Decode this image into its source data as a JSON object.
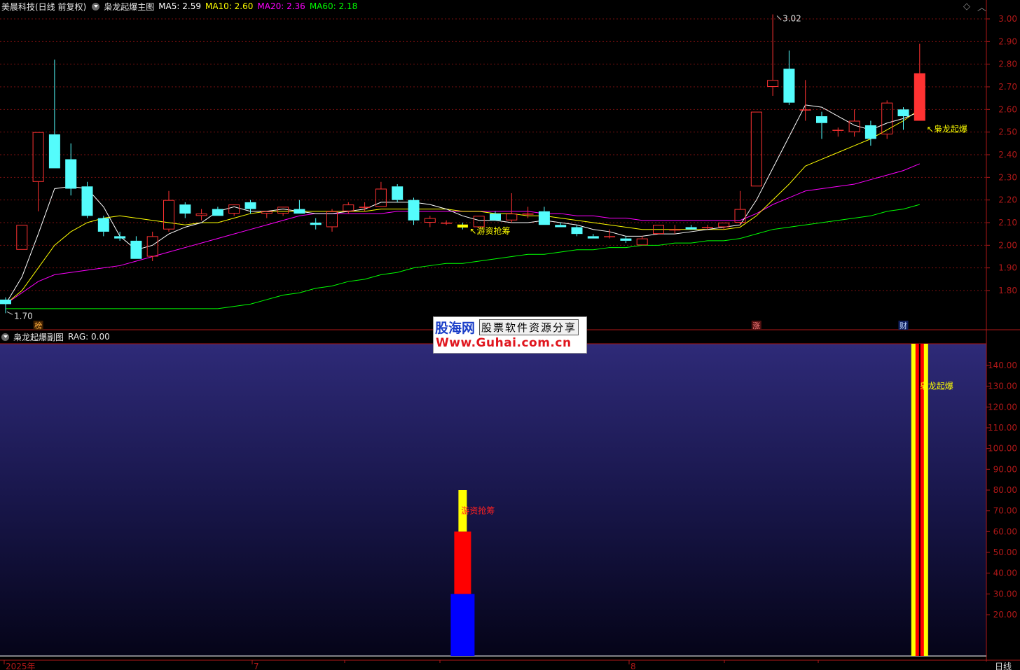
{
  "header": {
    "stock": "美晨科技(日线 前复权)",
    "indicator": "枭龙起爆主图",
    "ma": [
      {
        "label": "MA5: 2.59",
        "color": "#ffffff"
      },
      {
        "label": "MA10: 2.60",
        "color": "#ffff00"
      },
      {
        "label": "MA20: 2.36",
        "color": "#ff00ff"
      },
      {
        "label": "MA60: 2.18",
        "color": "#00ff00"
      }
    ]
  },
  "sub_header": {
    "title": "枭龙起爆副图",
    "value": "RAG: 0.00"
  },
  "watermark": {
    "brand": "股海网",
    "tagline": "股票软件资源分享",
    "url": "Www.Guhai.com.cn"
  },
  "x_axis": {
    "labels": [
      "2025年",
      "7",
      "8"
    ],
    "period": "日线"
  },
  "colors": {
    "up": "#ff3232",
    "down": "#54fcfc",
    "ma5": "#ffffff",
    "ma10": "#ffff00",
    "ma20": "#ff00ff",
    "ma60": "#00ff00",
    "axis": "#b01818"
  },
  "chart_data": [
    {
      "type": "candlestick",
      "ylim": [
        1.7,
        3.06
      ],
      "y_ticks": [
        1.8,
        1.9,
        2.0,
        2.1,
        2.2,
        2.3,
        2.4,
        2.5,
        2.6,
        2.7,
        2.8,
        2.9,
        3.0
      ],
      "candles": [
        {
          "o": 1.76,
          "h": 1.77,
          "l": 1.7,
          "c": 1.74
        },
        {
          "o": 1.98,
          "h": 2.09,
          "l": 1.98,
          "c": 2.09
        },
        {
          "o": 2.28,
          "h": 2.5,
          "l": 2.15,
          "c": 2.5
        },
        {
          "o": 2.49,
          "h": 2.82,
          "l": 2.34,
          "c": 2.34
        },
        {
          "o": 2.38,
          "h": 2.45,
          "l": 2.22,
          "c": 2.25
        },
        {
          "o": 2.26,
          "h": 2.28,
          "l": 2.12,
          "c": 2.13
        },
        {
          "o": 2.12,
          "h": 2.13,
          "l": 2.04,
          "c": 2.06
        },
        {
          "o": 2.04,
          "h": 2.06,
          "l": 2.02,
          "c": 2.03
        },
        {
          "o": 2.02,
          "h": 2.04,
          "l": 1.94,
          "c": 1.94
        },
        {
          "o": 1.95,
          "h": 2.06,
          "l": 1.93,
          "c": 2.04
        },
        {
          "o": 2.07,
          "h": 2.24,
          "l": 2.06,
          "c": 2.2
        },
        {
          "o": 2.18,
          "h": 2.19,
          "l": 2.12,
          "c": 2.14
        },
        {
          "o": 2.13,
          "h": 2.16,
          "l": 2.11,
          "c": 2.14
        },
        {
          "o": 2.16,
          "h": 2.17,
          "l": 2.13,
          "c": 2.13
        },
        {
          "o": 2.14,
          "h": 2.18,
          "l": 2.13,
          "c": 2.18
        },
        {
          "o": 2.19,
          "h": 2.2,
          "l": 2.14,
          "c": 2.16
        },
        {
          "o": 2.14,
          "h": 2.15,
          "l": 2.12,
          "c": 2.15
        },
        {
          "o": 2.14,
          "h": 2.17,
          "l": 2.13,
          "c": 2.17
        },
        {
          "o": 2.16,
          "h": 2.2,
          "l": 2.14,
          "c": 2.14
        },
        {
          "o": 2.1,
          "h": 2.12,
          "l": 2.07,
          "c": 2.09
        },
        {
          "o": 2.08,
          "h": 2.16,
          "l": 2.06,
          "c": 2.15
        },
        {
          "o": 2.15,
          "h": 2.19,
          "l": 2.14,
          "c": 2.18
        },
        {
          "o": 2.17,
          "h": 2.19,
          "l": 2.15,
          "c": 2.17
        },
        {
          "o": 2.17,
          "h": 2.28,
          "l": 2.17,
          "c": 2.25
        },
        {
          "o": 2.26,
          "h": 2.27,
          "l": 2.19,
          "c": 2.2
        },
        {
          "o": 2.2,
          "h": 2.21,
          "l": 2.09,
          "c": 2.11
        },
        {
          "o": 2.1,
          "h": 2.13,
          "l": 2.08,
          "c": 2.12
        },
        {
          "o": 2.1,
          "h": 2.11,
          "l": 2.09,
          "c": 2.1
        },
        {
          "o": 2.09,
          "h": 2.1,
          "l": 2.07,
          "c": 2.08
        },
        {
          "o": 2.08,
          "h": 2.13,
          "l": 2.08,
          "c": 2.13
        },
        {
          "o": 2.14,
          "h": 2.15,
          "l": 2.11,
          "c": 2.11
        },
        {
          "o": 2.11,
          "h": 2.23,
          "l": 2.1,
          "c": 2.14
        },
        {
          "o": 2.14,
          "h": 2.17,
          "l": 2.12,
          "c": 2.14
        },
        {
          "o": 2.15,
          "h": 2.17,
          "l": 2.09,
          "c": 2.09
        },
        {
          "o": 2.09,
          "h": 2.1,
          "l": 2.08,
          "c": 2.08
        },
        {
          "o": 2.08,
          "h": 2.09,
          "l": 2.04,
          "c": 2.05
        },
        {
          "o": 2.04,
          "h": 2.05,
          "l": 2.03,
          "c": 2.03
        },
        {
          "o": 2.04,
          "h": 2.07,
          "l": 2.03,
          "c": 2.04
        },
        {
          "o": 2.03,
          "h": 2.04,
          "l": 2.01,
          "c": 2.02
        },
        {
          "o": 2.0,
          "h": 2.04,
          "l": 2.0,
          "c": 2.03
        },
        {
          "o": 2.05,
          "h": 2.09,
          "l": 2.05,
          "c": 2.09
        },
        {
          "o": 2.07,
          "h": 2.09,
          "l": 2.05,
          "c": 2.07
        },
        {
          "o": 2.08,
          "h": 2.09,
          "l": 2.07,
          "c": 2.07
        },
        {
          "o": 2.08,
          "h": 2.09,
          "l": 2.07,
          "c": 2.08
        },
        {
          "o": 2.08,
          "h": 2.1,
          "l": 2.07,
          "c": 2.1
        },
        {
          "o": 2.1,
          "h": 2.24,
          "l": 2.09,
          "c": 2.16
        },
        {
          "o": 2.26,
          "h": 2.59,
          "l": 2.26,
          "c": 2.59
        },
        {
          "o": 2.7,
          "h": 3.02,
          "l": 2.66,
          "c": 2.73
        },
        {
          "o": 2.78,
          "h": 2.86,
          "l": 2.62,
          "c": 2.63
        },
        {
          "o": 2.6,
          "h": 2.73,
          "l": 2.55,
          "c": 2.6
        },
        {
          "o": 2.57,
          "h": 2.59,
          "l": 2.47,
          "c": 2.54
        },
        {
          "o": 2.51,
          "h": 2.52,
          "l": 2.48,
          "c": 2.51
        },
        {
          "o": 2.5,
          "h": 2.6,
          "l": 2.48,
          "c": 2.55
        },
        {
          "o": 2.53,
          "h": 2.55,
          "l": 2.44,
          "c": 2.47
        },
        {
          "o": 2.49,
          "h": 2.64,
          "l": 2.47,
          "c": 2.63
        },
        {
          "o": 2.6,
          "h": 2.61,
          "l": 2.51,
          "c": 2.57
        },
        {
          "o": 2.55,
          "h": 2.89,
          "l": 2.55,
          "c": 2.76
        }
      ],
      "ma5": [
        1.74,
        1.86,
        2.05,
        2.25,
        2.26,
        2.25,
        2.17,
        2.04,
        1.98,
        2.0,
        2.05,
        2.08,
        2.1,
        2.15,
        2.17,
        2.15,
        2.15,
        2.16,
        2.15,
        2.14,
        2.14,
        2.15,
        2.16,
        2.19,
        2.19,
        2.19,
        2.18,
        2.16,
        2.13,
        2.11,
        2.11,
        2.1,
        2.1,
        2.11,
        2.1,
        2.09,
        2.07,
        2.06,
        2.04,
        2.04,
        2.05,
        2.05,
        2.06,
        2.07,
        2.08,
        2.09,
        2.2,
        2.34,
        2.48,
        2.62,
        2.61,
        2.57,
        2.53,
        2.51,
        2.54,
        2.56,
        2.59
      ],
      "ma10": [
        1.74,
        1.8,
        1.9,
        2.0,
        2.06,
        2.1,
        2.12,
        2.13,
        2.12,
        2.11,
        2.1,
        2.09,
        2.1,
        2.1,
        2.12,
        2.14,
        2.15,
        2.15,
        2.15,
        2.15,
        2.15,
        2.15,
        2.15,
        2.16,
        2.16,
        2.16,
        2.16,
        2.16,
        2.15,
        2.15,
        2.14,
        2.14,
        2.13,
        2.13,
        2.12,
        2.11,
        2.1,
        2.09,
        2.08,
        2.07,
        2.07,
        2.07,
        2.07,
        2.07,
        2.07,
        2.08,
        2.13,
        2.2,
        2.27,
        2.35,
        2.38,
        2.41,
        2.44,
        2.47,
        2.51,
        2.55,
        2.6
      ],
      "ma20": [
        1.74,
        1.79,
        1.84,
        1.87,
        1.88,
        1.89,
        1.9,
        1.91,
        1.93,
        1.95,
        1.97,
        1.99,
        2.01,
        2.03,
        2.05,
        2.07,
        2.09,
        2.11,
        2.13,
        2.14,
        2.14,
        2.14,
        2.14,
        2.14,
        2.15,
        2.15,
        2.15,
        2.15,
        2.15,
        2.15,
        2.15,
        2.15,
        2.15,
        2.14,
        2.14,
        2.13,
        2.13,
        2.12,
        2.12,
        2.11,
        2.11,
        2.11,
        2.11,
        2.11,
        2.11,
        2.11,
        2.14,
        2.18,
        2.21,
        2.24,
        2.25,
        2.26,
        2.27,
        2.29,
        2.31,
        2.33,
        2.36
      ],
      "ma60": [
        1.72,
        1.72,
        1.72,
        1.72,
        1.72,
        1.72,
        1.72,
        1.72,
        1.72,
        1.72,
        1.72,
        1.72,
        1.72,
        1.72,
        1.73,
        1.74,
        1.76,
        1.78,
        1.79,
        1.81,
        1.82,
        1.84,
        1.85,
        1.87,
        1.88,
        1.9,
        1.91,
        1.92,
        1.92,
        1.93,
        1.94,
        1.95,
        1.96,
        1.96,
        1.97,
        1.98,
        1.98,
        1.99,
        1.99,
        2.0,
        2.0,
        2.01,
        2.01,
        2.02,
        2.02,
        2.03,
        2.05,
        2.07,
        2.08,
        2.09,
        2.1,
        2.11,
        2.12,
        2.13,
        2.15,
        2.16,
        2.18
      ],
      "price_labels": [
        {
          "text": "3.02",
          "index": 47,
          "value": 3.02
        },
        {
          "text": "1.70",
          "index": 0,
          "value": 1.7
        }
      ],
      "signals": [
        {
          "text": "游资抢筹",
          "index": 28,
          "value": 2.1,
          "color": "#ffff00"
        },
        {
          "text": "枭龙起爆",
          "index": 56,
          "value": 2.55,
          "color": "#ffff00"
        }
      ],
      "markers": [
        {
          "text": "榜",
          "index": 2,
          "color": "#ffb040",
          "bg": "#402000"
        },
        {
          "text": "涨",
          "index": 46,
          "color": "#ff8080",
          "bg": "#501010"
        },
        {
          "text": "财",
          "index": 55,
          "color": "#c0d8ff",
          "bg": "#102060"
        }
      ],
      "yellow_box_index": 28
    },
    {
      "type": "bar",
      "ylim": [
        0,
        150
      ],
      "y_ticks": [
        20.0,
        30.0,
        40.0,
        50.0,
        60.0,
        70.0,
        80.0,
        90.0,
        100.0,
        110.0,
        120.0,
        130.0,
        140.0
      ],
      "stacks": [
        {
          "index": 28,
          "segments": [
            {
              "from": 0,
              "to": 30,
              "color": "#0000ff"
            },
            {
              "from": 30,
              "to": 60,
              "color": "#ff0000"
            },
            {
              "from": 60,
              "to": 80,
              "color": "#ffff00"
            }
          ],
          "label": "游资抢筹",
          "label_value": 70,
          "label_color": "#ff2020"
        },
        {
          "index": 56,
          "segments": [
            {
              "from": 0,
              "to": 150,
              "color": "#ffff00"
            }
          ],
          "inner_color": "#ff0000",
          "label": "枭龙起爆",
          "label_value": 130,
          "label_color": "#ffff00"
        }
      ]
    }
  ]
}
